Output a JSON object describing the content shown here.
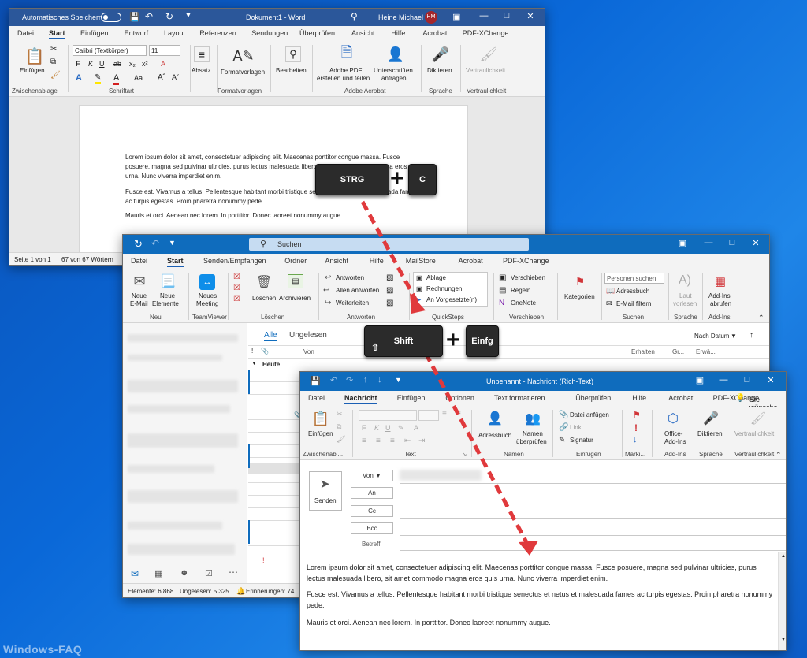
{
  "word": {
    "autosave": "Automatisches Speichern",
    "title": "Dokument1 - Word",
    "user": "Heine Michael",
    "initials": "HM",
    "tabs": [
      "Datei",
      "Start",
      "Einfügen",
      "Entwurf",
      "Layout",
      "Referenzen",
      "Sendungen",
      "Überprüfen",
      "Ansicht",
      "Hilfe",
      "Acrobat",
      "PDF-XChange"
    ],
    "font_name": "Calibri (Textkörper)",
    "font_size": "11",
    "buttons": {
      "paste": "Einfügen",
      "paragraph": "Absatz",
      "styles": "Formatvorlagen",
      "edit": "Bearbeiten",
      "adobe1": "Adobe PDF",
      "adobe2": "erstellen und teilen",
      "sign1": "Unterschriften",
      "sign2": "anfragen",
      "dictate": "Diktieren",
      "sensitivity": "Vertraulichkeit"
    },
    "groups": {
      "clipboard": "Zwischenablage",
      "font": "Schriftart",
      "styles": "Formatvorlagen",
      "acrobat": "Adobe Acrobat",
      "speech": "Sprache",
      "sensitivity": "Vertraulichkeit"
    },
    "para1": "Lorem ipsum dolor sit amet, consectetuer adipiscing elit. Maecenas porttitor congue massa. Fusce posuere, magna sed pulvinar ultricies, purus lectus malesuada libero, sit amet commodo magna eros quis urna. Nunc viverra imperdiet enim.",
    "para2": "Fusce est. Vivamus a tellus. Pellentesque habitant morbi tristique senectus et netus et malesuada fames ac turpis egestas. Proin pharetra nonummy pede.",
    "para3": "Mauris et orci. Aenean nec lorem. In porttitor. Donec laoreet nonummy augue.",
    "status_page": "Seite 1 von 1",
    "status_words": "67 von 67 Wörtern"
  },
  "outlook": {
    "search": "Suchen",
    "tabs": [
      "Datei",
      "Start",
      "Senden/Empfangen",
      "Ordner",
      "Ansicht",
      "Hilfe",
      "MailStore",
      "Acrobat",
      "PDF-XChange"
    ],
    "buttons": {
      "new_email1": "Neue",
      "new_email2": "E-Mail",
      "new_items1": "Neue",
      "new_items2": "Elemente",
      "meeting1": "Neues",
      "meeting2": "Meeting",
      "delete": "Löschen",
      "archive": "Archivieren",
      "reply": "Antworten",
      "reply_all": "Allen antworten",
      "forward": "Weiterleiten",
      "qs1": "Ablage",
      "qs2": "Rechnungen",
      "qs3": "An Vorgesetzte(n)",
      "move": "Verschieben",
      "rules": "Regeln",
      "onenote": "OneNote",
      "categories": "Kategorien",
      "people_search": "Personen suchen",
      "address_book": "Adressbuch",
      "filter": "E-Mail filtern",
      "read_aloud1": "Laut",
      "read_aloud2": "vorlesen",
      "addins1": "Add-Ins",
      "addins2": "abrufen"
    },
    "groups": {
      "new": "Neu",
      "teamviewer": "TeamViewer",
      "delete": "Löschen",
      "respond": "Antworten",
      "quicksteps": "QuickSteps",
      "move": "Verschieben",
      "find": "Suchen",
      "speech": "Sprache",
      "addins": "Add-Ins"
    },
    "filter_all": "Alle",
    "filter_unread": "Ungelesen",
    "sort": "Nach Datum",
    "col_from": "Von",
    "col_received": "Erhalten",
    "col_size": "Gr...",
    "col_extra": "Erwä...",
    "today": "Heute",
    "status_items": "Elemente: 6.868",
    "status_unread": "Ungelesen: 5.325",
    "status_reminders": "Erinnerungen: 74"
  },
  "message": {
    "title": "Unbenannt  -  Nachricht (Rich-Text)",
    "tabs": [
      "Datei",
      "Nachricht",
      "Einfügen",
      "Optionen",
      "Text formatieren",
      "Überprüfen",
      "Hilfe",
      "Acrobat",
      "PDF-XChange"
    ],
    "tell_me": "Sie wünsche",
    "buttons": {
      "paste": "Einfügen",
      "address_book": "Adressbuch",
      "check_names1": "Namen",
      "check_names2": "überprüfen",
      "attach": "Datei anfügen",
      "link": "Link",
      "signature": "Signatur",
      "office1": "Office-",
      "office2": "Add-Ins",
      "dictate": "Diktieren",
      "sensitivity": "Vertraulichkeit"
    },
    "groups": {
      "clipboard": "Zwischenabl...",
      "text": "Text",
      "names": "Namen",
      "include": "Einfügen",
      "tags": "Marki...",
      "addins": "Add-Ins",
      "speech": "Sprache",
      "sensitivity": "Vertraulichkeit"
    },
    "send": "Senden",
    "from": "Von",
    "to": "An",
    "cc": "Cc",
    "bcc": "Bcc",
    "subject": "Betreff",
    "body1": "Lorem ipsum dolor sit amet, consectetuer adipiscing elit. Maecenas porttitor congue massa. Fusce posuere, magna sed pulvinar ultricies, purus lectus malesuada libero, sit amet commodo magna eros quis urna. Nunc viverra imperdiet enim.",
    "body2": "Fusce est. Vivamus a tellus. Pellentesque habitant morbi tristique senectus et netus et malesuada fames ac turpis egestas. Proin pharetra nonummy pede.",
    "body3": "Mauris et orci. Aenean nec lorem. In porttitor. Donec laoreet nonummy augue."
  },
  "keys": {
    "ctrl": "STRG",
    "c": "C",
    "shift": "Shift",
    "insert": "Einfg"
  },
  "watermark": "Windows-FAQ",
  "colors": {
    "word_blue": "#2b579a",
    "outlook_blue": "#0f6cbd",
    "arrow": "#e0393c"
  }
}
